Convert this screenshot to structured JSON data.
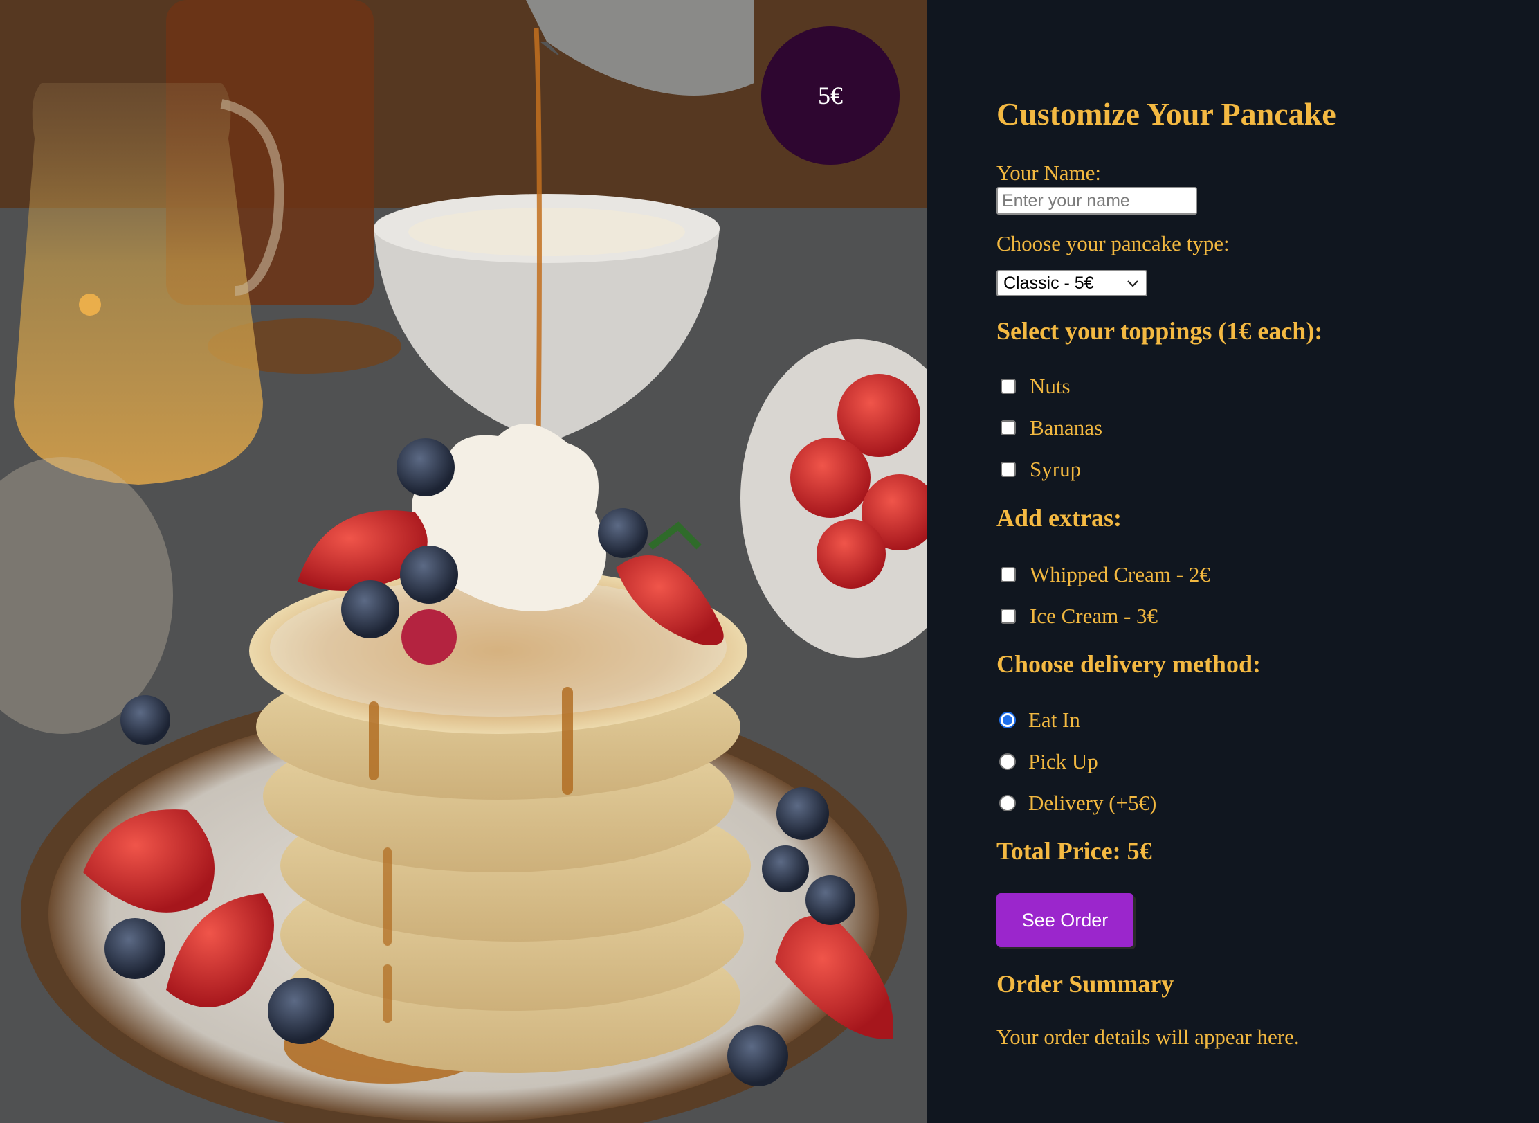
{
  "hero": {
    "badge_price": "5€"
  },
  "form": {
    "title": "Customize Your Pancake",
    "name_label": "Your Name:",
    "name_placeholder": "Enter your name",
    "name_value": "",
    "type_label": "Choose your pancake type:",
    "type_selected": "Classic - 5€",
    "toppings_heading": "Select your toppings (1€ each):",
    "toppings": [
      {
        "label": "Nuts",
        "checked": false
      },
      {
        "label": "Bananas",
        "checked": false
      },
      {
        "label": "Syrup",
        "checked": false
      }
    ],
    "extras_heading": "Add extras:",
    "extras": [
      {
        "label": "Whipped Cream - 2€",
        "checked": false
      },
      {
        "label": "Ice Cream - 3€",
        "checked": false
      }
    ],
    "delivery_heading": "Choose delivery method:",
    "delivery": [
      {
        "label": "Eat In",
        "checked": true
      },
      {
        "label": "Pick Up",
        "checked": false
      },
      {
        "label": "Delivery (+5€)",
        "checked": false
      }
    ],
    "total_label": "Total Price: 5€",
    "see_order_button": "See Order",
    "summary_heading": "Order Summary",
    "summary_text": "Your order details will appear here."
  },
  "colors": {
    "panel_bg": "#10161f",
    "accent_text": "#f4b942",
    "button_bg": "#9b26cc",
    "badge_bg": "#2e0630",
    "radio_selected": "#1f6feb"
  }
}
